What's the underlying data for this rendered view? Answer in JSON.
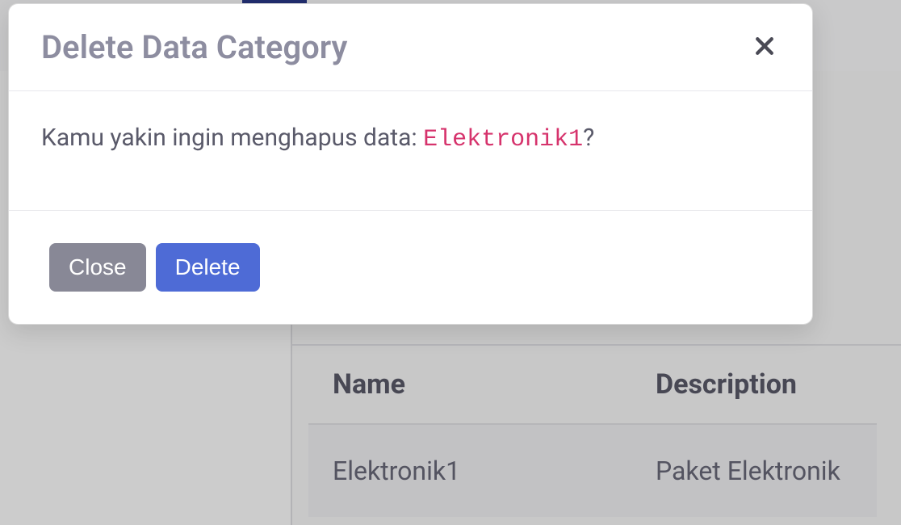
{
  "modal": {
    "title": "Delete Data Category",
    "confirm_prefix": "Kamu yakin ingin menghapus data: ",
    "confirm_item": "Elektronik1",
    "confirm_suffix": "?",
    "close_label": "Close",
    "delete_label": "Delete"
  },
  "table": {
    "headers": {
      "name": "Name",
      "description": "Description"
    },
    "rows": [
      {
        "name": "Elektronik1",
        "description": "Paket Elektronik"
      }
    ]
  }
}
